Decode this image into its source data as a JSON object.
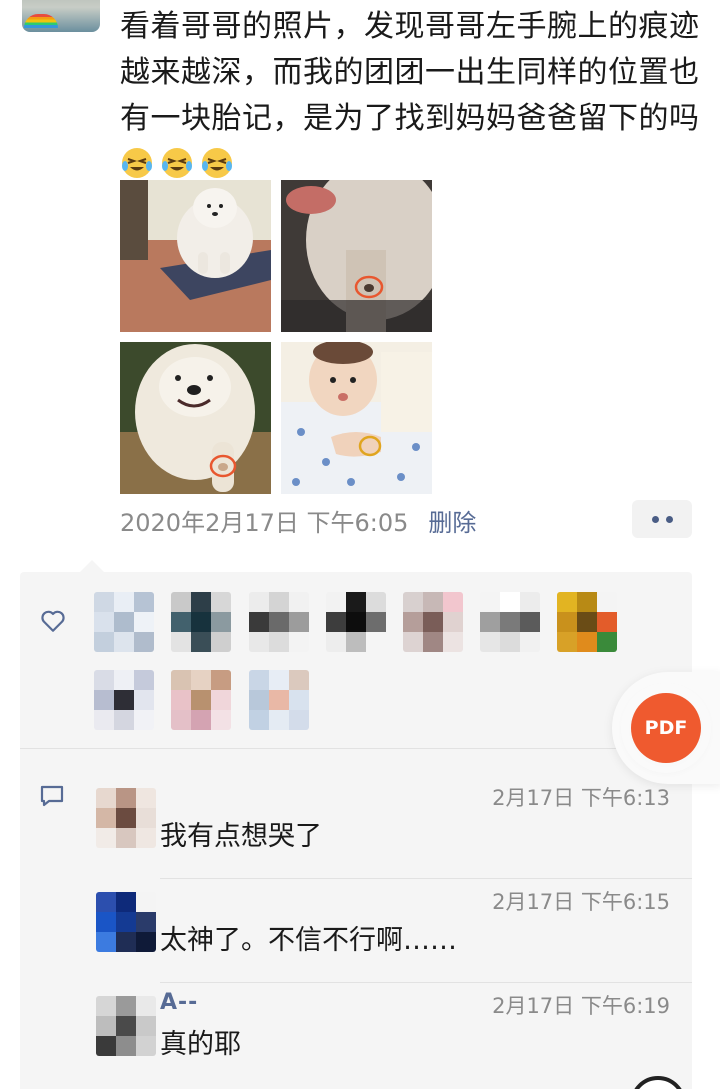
{
  "post": {
    "text": "看着哥哥的照片，发现哥哥左手腕上的痕迹越来越深，而我的团团一出生同样的位置也有一块胎记，是为了找到妈妈爸爸留下的吗",
    "emojis": [
      "tears-of-joy-emoji",
      "tears-of-joy-emoji",
      "tears-of-joy-emoji"
    ],
    "photos": [
      "dog-sitting-photo",
      "dog-paw-marked-photo",
      "dog-smiling-photo",
      "baby-wrist-marked-photo"
    ],
    "time": "2020年2月17日 下午6:05",
    "delete_label": "删除"
  },
  "likes": {
    "icon": "heart-outline-icon",
    "avatar_count": 10
  },
  "comments": [
    {
      "name": "",
      "time": "2月17日  下午6:13",
      "text": "我有点想哭了"
    },
    {
      "name": "",
      "time": "2月17日  下午6:15",
      "text": "太神了。不信不行啊……"
    },
    {
      "name": "A--",
      "time": "2月17日  下午6:19",
      "text": "真的耶"
    }
  ],
  "pdf_button": {
    "label": "PDF"
  },
  "colors": {
    "link": "#576b95",
    "panel_bg": "#f5f5f5",
    "pdf_accent": "#ef5a2f",
    "meta_text": "#8a8a8a"
  }
}
